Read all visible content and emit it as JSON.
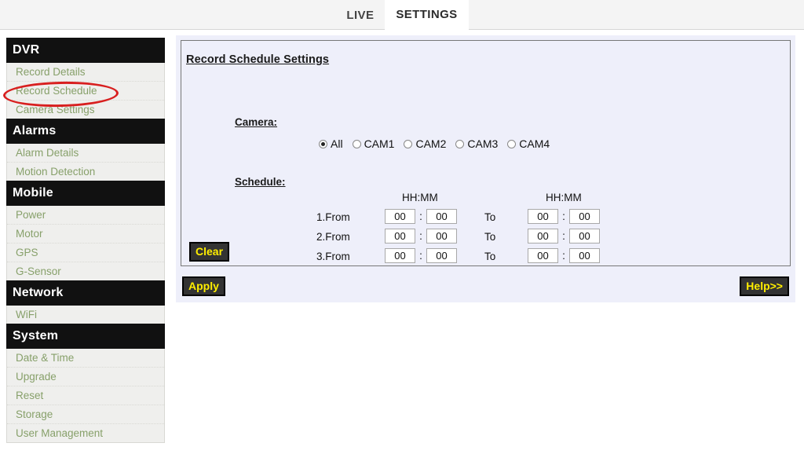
{
  "tabs": [
    {
      "label": "LIVE",
      "active": false
    },
    {
      "label": "SETTINGS",
      "active": true
    }
  ],
  "sidebar": {
    "sections": [
      {
        "title": "DVR",
        "items": [
          {
            "label": "Record Details",
            "highlighted": false
          },
          {
            "label": "Record Schedule",
            "highlighted": true
          },
          {
            "label": "Camera Settings",
            "highlighted": false
          }
        ]
      },
      {
        "title": "Alarms",
        "items": [
          {
            "label": "Alarm Details",
            "highlighted": false
          },
          {
            "label": "Motion Detection",
            "highlighted": false
          }
        ]
      },
      {
        "title": "Mobile",
        "items": [
          {
            "label": "Power",
            "highlighted": false
          },
          {
            "label": "Motor",
            "highlighted": false
          },
          {
            "label": "GPS",
            "highlighted": false
          },
          {
            "label": "G-Sensor",
            "highlighted": false
          }
        ]
      },
      {
        "title": "Network",
        "items": [
          {
            "label": "WiFi",
            "highlighted": false
          }
        ]
      },
      {
        "title": "System",
        "items": [
          {
            "label": "Date & Time",
            "highlighted": false
          },
          {
            "label": "Upgrade",
            "highlighted": false
          },
          {
            "label": "Reset",
            "highlighted": false
          },
          {
            "label": "Storage",
            "highlighted": false
          },
          {
            "label": "User Management",
            "highlighted": false
          }
        ]
      }
    ],
    "annotation": {
      "shape": "red-ellipse",
      "target": "Record Schedule",
      "color": "#d81f1f"
    }
  },
  "panel": {
    "title": "Record Schedule Settings",
    "camera": {
      "label": "Camera:",
      "options": [
        {
          "label": "All",
          "selected": true
        },
        {
          "label": "CAM1",
          "selected": false
        },
        {
          "label": "CAM2",
          "selected": false
        },
        {
          "label": "CAM3",
          "selected": false
        },
        {
          "label": "CAM4",
          "selected": false
        }
      ]
    },
    "schedule": {
      "label": "Schedule:",
      "column_headers": [
        "HH:MM",
        "HH:MM"
      ],
      "to_label": "To",
      "colon": ":",
      "rows": [
        {
          "label": "1.From",
          "from_hh": "00",
          "from_mm": "00",
          "to_hh": "00",
          "to_mm": "00"
        },
        {
          "label": "2.From",
          "from_hh": "00",
          "from_mm": "00",
          "to_hh": "00",
          "to_mm": "00"
        },
        {
          "label": "3.From",
          "from_hh": "00",
          "from_mm": "00",
          "to_hh": "00",
          "to_mm": "00"
        }
      ]
    },
    "clear_label": "Clear"
  },
  "footer": {
    "apply_label": "Apply",
    "help_label": "Help>>"
  },
  "colors": {
    "panel_bg": "#eeeffa",
    "section_header_bg": "#111111",
    "nav_text": "#87a06a",
    "button_bg": "#333333",
    "button_text": "#ffee00",
    "annotation": "#d81f1f"
  }
}
